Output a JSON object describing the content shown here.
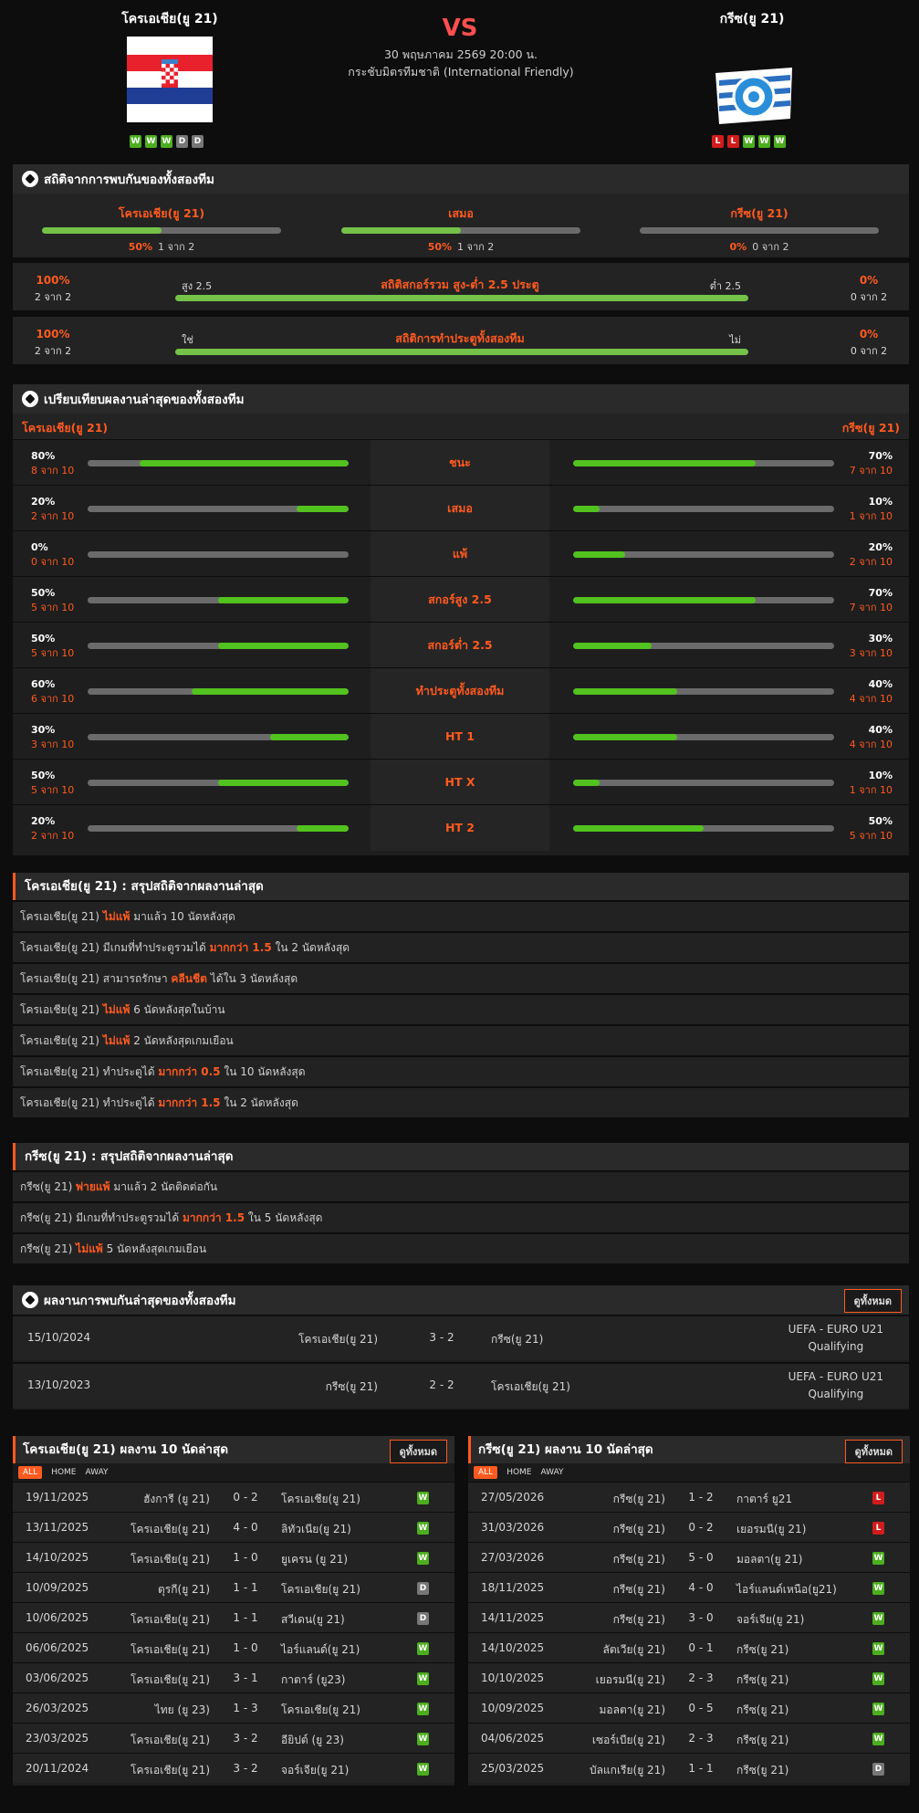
{
  "header": {
    "home": "โครเอเชีย(ยู 21)",
    "away": "กรีซ(ยู 21)",
    "vs": "VS",
    "datetime": "30 พฤษภาคม 2569 20:00 น.",
    "competition": "กระชับมิตรทีมชาติ (International Friendly)",
    "home_form": [
      "W",
      "W",
      "W",
      "D",
      "D"
    ],
    "away_form": [
      "L",
      "L",
      "W",
      "W",
      "W"
    ]
  },
  "h2h_stats": {
    "title": "สถิติจากการพบกันของทั้งสองทีม",
    "cols": [
      {
        "label": "โครเอเชีย(ยู 21)",
        "pct": "50%",
        "count": "1 จาก 2",
        "fill": 0.5
      },
      {
        "label": "เสมอ",
        "pct": "50%",
        "count": "1 จาก 2",
        "fill": 0.5
      },
      {
        "label": "กรีซ(ยู 21)",
        "pct": "0%",
        "count": "0 จาก 2",
        "fill": 0
      }
    ],
    "ou": {
      "left_pct": "100%",
      "left_count": "2 จาก 2",
      "left_label": "สูง 2.5",
      "title": "สถิติสกอร์รวม สูง-ต่ำ 2.5 ประตู",
      "right_label": "ต่ำ 2.5",
      "right_pct": "0%",
      "right_count": "0 จาก 2",
      "fill": 1
    },
    "btts": {
      "left_pct": "100%",
      "left_count": "2 จาก 2",
      "left_label": "ใช่",
      "title": "สถิติการทำประตูทั้งสองทีม",
      "right_label": "ไม่",
      "right_pct": "0%",
      "right_count": "0 จาก 2",
      "fill": 1
    }
  },
  "compare": {
    "title": "เปรียบเทียบผลงานล่าสุดของทั้งสองทีม",
    "home": "โครเอเชีย(ยู 21)",
    "away": "กรีซ(ยู 21)",
    "rows": [
      {
        "label": "ชนะ",
        "hp": "80%",
        "hc": "8 จาก 10",
        "hf": 0.8,
        "ap": "70%",
        "ac": "7 จาก 10",
        "af": 0.7
      },
      {
        "label": "เสมอ",
        "hp": "20%",
        "hc": "2 จาก 10",
        "hf": 0.2,
        "ap": "10%",
        "ac": "1 จาก 10",
        "af": 0.1
      },
      {
        "label": "แพ้",
        "hp": "0%",
        "hc": "0 จาก 10",
        "hf": 0,
        "ap": "20%",
        "ac": "2 จาก 10",
        "af": 0.2
      },
      {
        "label": "สกอร์สูง 2.5",
        "hp": "50%",
        "hc": "5 จาก 10",
        "hf": 0.5,
        "ap": "70%",
        "ac": "7 จาก 10",
        "af": 0.7
      },
      {
        "label": "สกอร์ต่ำ 2.5",
        "hp": "50%",
        "hc": "5 จาก 10",
        "hf": 0.5,
        "ap": "30%",
        "ac": "3 จาก 10",
        "af": 0.3
      },
      {
        "label": "ทำประตูทั้งสองทีม",
        "hp": "60%",
        "hc": "6 จาก 10",
        "hf": 0.6,
        "ap": "40%",
        "ac": "4 จาก 10",
        "af": 0.4
      },
      {
        "label": "HT 1",
        "hp": "30%",
        "hc": "3 จาก 10",
        "hf": 0.3,
        "ap": "40%",
        "ac": "4 จาก 10",
        "af": 0.4
      },
      {
        "label": "HT X",
        "hp": "50%",
        "hc": "5 จาก 10",
        "hf": 0.5,
        "ap": "10%",
        "ac": "1 จาก 10",
        "af": 0.1
      },
      {
        "label": "HT 2",
        "hp": "20%",
        "hc": "2 จาก 10",
        "hf": 0.2,
        "ap": "50%",
        "ac": "5 จาก 10",
        "af": 0.5
      }
    ]
  },
  "home_summary": {
    "title": "โครเอเชีย(ยู 21) : สรุปสถิติจากผลงานล่าสุด",
    "rows": [
      [
        "โครเอเชีย(ยู 21)",
        "ไม่แพ้",
        "มาแล้ว 10 นัดหลังสุด"
      ],
      [
        "โครเอเชีย(ยู 21) มีเกมที่ทำประตูรวมได้",
        "มากกว่า 1.5",
        "ใน 2 นัดหลังสุด"
      ],
      [
        "โครเอเชีย(ยู 21) สามารถรักษา",
        "คลีนชีต",
        "ได้ใน 3 นัดหลังสุด"
      ],
      [
        "โครเอเชีย(ยู 21)",
        "ไม่แพ้",
        "6 นัดหลังสุดในบ้าน"
      ],
      [
        "โครเอเชีย(ยู 21)",
        "ไม่แพ้",
        "2 นัดหลังสุดเกมเยือน"
      ],
      [
        "โครเอเชีย(ยู 21) ทำประตูได้",
        "มากกว่า 0.5",
        "ใน 10 นัดหลังสุด"
      ],
      [
        "โครเอเชีย(ยู 21) ทำประตูได้",
        "มากกว่า 1.5",
        "ใน 2 นัดหลังสุด"
      ]
    ]
  },
  "away_summary": {
    "title": "กรีซ(ยู 21) : สรุปสถิติจากผลงานล่าสุด",
    "rows": [
      [
        "กรีซ(ยู 21)",
        "พ่ายแพ้",
        "มาแล้ว 2 นัดติดต่อกัน"
      ],
      [
        "กรีซ(ยู 21) มีเกมที่ทำประตูรวมได้",
        "มากกว่า 1.5",
        "ใน 5 นัดหลังสุด"
      ],
      [
        "กรีซ(ยู 21)",
        "ไม่แพ้",
        "5 นัดหลังสุดเกมเยือน"
      ]
    ]
  },
  "h2h_results": {
    "title": "ผลงานการพบกันล่าสุดของทั้งสองทีม",
    "view_all": "ดูทั้งหมด",
    "rows": [
      {
        "date": "15/10/2024",
        "home": "โครเอเชีย(ยู 21)",
        "score": "3 - 2",
        "away": "กรีซ(ยู 21)",
        "comp1": "UEFA - EURO U21",
        "comp2": "Qualifying"
      },
      {
        "date": "13/10/2023",
        "home": "กรีซ(ยู 21)",
        "score": "2 - 2",
        "away": "โครเอเชีย(ยู 21)",
        "comp1": "UEFA - EURO U21",
        "comp2": "Qualifying"
      }
    ]
  },
  "tabs": [
    "ALL",
    "HOME",
    "AWAY"
  ],
  "home_recent": {
    "title": "โครเอเชีย(ยู 21) ผลงาน 10 นัดล่าสุด",
    "view_all": "ดูทั้งหมด",
    "rows": [
      [
        "19/11/2025",
        "ฮังการี (ยู 21)",
        "0 - 2",
        "โครเอเชีย(ยู 21)",
        "W"
      ],
      [
        "13/11/2025",
        "โครเอเชีย(ยู 21)",
        "4 - 0",
        "ลิทัวเนีย(ยู 21)",
        "W"
      ],
      [
        "14/10/2025",
        "โครเอเชีย(ยู 21)",
        "1 - 0",
        "ยูเครน (ยู 21)",
        "W"
      ],
      [
        "10/09/2025",
        "ตุรกี(ยู 21)",
        "1 - 1",
        "โครเอเชีย(ยู 21)",
        "D"
      ],
      [
        "10/06/2025",
        "โครเอเชีย(ยู 21)",
        "1 - 1",
        "สวีเดน(ยู 21)",
        "D"
      ],
      [
        "06/06/2025",
        "โครเอเชีย(ยู 21)",
        "1 - 0",
        "ไอร์แลนด์(ยู 21)",
        "W"
      ],
      [
        "03/06/2025",
        "โครเอเชีย(ยู 21)",
        "3 - 1",
        "กาตาร์ (ยู23)",
        "W"
      ],
      [
        "26/03/2025",
        "ไทย (ยู 23)",
        "1 - 3",
        "โครเอเชีย(ยู 21)",
        "W"
      ],
      [
        "23/03/2025",
        "โครเอเชีย(ยู 21)",
        "3 - 2",
        "อียิปต์ (ยู 23)",
        "W"
      ],
      [
        "20/11/2024",
        "โครเอเชีย(ยู 21)",
        "3 - 2",
        "จอร์เจีย(ยู 21)",
        "W"
      ]
    ]
  },
  "away_recent": {
    "title": "กรีซ(ยู 21) ผลงาน 10 นัดล่าสุด",
    "view_all": "ดูทั้งหมด",
    "rows": [
      [
        "27/05/2026",
        "กรีซ(ยู 21)",
        "1 - 2",
        "กาตาร์ ยู21",
        "L"
      ],
      [
        "31/03/2026",
        "กรีซ(ยู 21)",
        "0 - 2",
        "เยอรมนี(ยู 21)",
        "L"
      ],
      [
        "27/03/2026",
        "กรีซ(ยู 21)",
        "5 - 0",
        "มอลตา(ยู 21)",
        "W"
      ],
      [
        "18/11/2025",
        "กรีซ(ยู 21)",
        "4 - 0",
        "ไอร์แลนด์เหนือ(ยู21)",
        "W"
      ],
      [
        "14/11/2025",
        "กรีซ(ยู 21)",
        "3 - 0",
        "จอร์เจีย(ยู 21)",
        "W"
      ],
      [
        "14/10/2025",
        "ลัตเวีย(ยู 21)",
        "0 - 1",
        "กรีซ(ยู 21)",
        "W"
      ],
      [
        "10/10/2025",
        "เยอรมนี(ยู 21)",
        "2 - 3",
        "กรีซ(ยู 21)",
        "W"
      ],
      [
        "10/09/2025",
        "มอลตา(ยู 21)",
        "0 - 5",
        "กรีซ(ยู 21)",
        "W"
      ],
      [
        "04/06/2025",
        "เซอร์เบีย(ยู 21)",
        "2 - 3",
        "กรีซ(ยู 21)",
        "W"
      ],
      [
        "25/03/2025",
        "บัลแกเรีย(ยู 21)",
        "1 - 1",
        "กรีซ(ยู 21)",
        "D"
      ]
    ]
  }
}
